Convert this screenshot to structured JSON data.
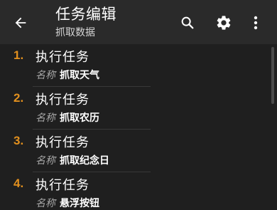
{
  "toolbar": {
    "title": "任务编辑",
    "subtitle": "抓取数据",
    "icons": [
      "arrow-left-icon",
      "search-icon",
      "gear-icon",
      "more-vertical-icon"
    ]
  },
  "tasks": [
    {
      "index": "1.",
      "action": "执行任务",
      "key": "名称",
      "value": "抓取天气"
    },
    {
      "index": "2.",
      "action": "执行任务",
      "key": "名称",
      "value": "抓取农历"
    },
    {
      "index": "3.",
      "action": "执行任务",
      "key": "名称",
      "value": "抓取纪念日"
    },
    {
      "index": "4.",
      "action": "执行任务",
      "key": "名称",
      "value": "悬浮按钮"
    }
  ],
  "colors": {
    "accent": "#e2901e",
    "toolbar": "#2a2a2a",
    "background": "#1f1f1f"
  }
}
